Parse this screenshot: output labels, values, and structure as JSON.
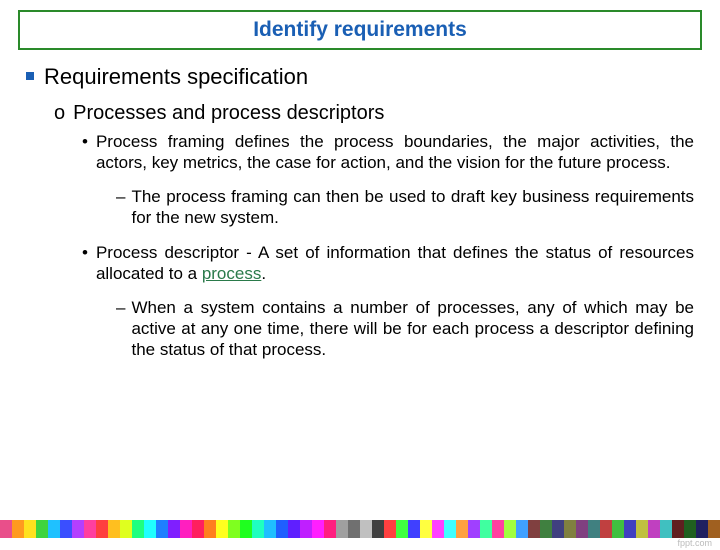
{
  "title": "Identify requirements",
  "lvl1": "Requirements specification",
  "lvl2": "Processes and process descriptors",
  "lvl3a": "Process framing defines the process boundaries, the major activities, the actors, key metrics, the case for action, and the vision for the future process.",
  "lvl4a": "The process framing can then be used to draft key business requirements for the new system.",
  "lvl3b_pre": "Process descriptor - A set of information that defines the status of resources allocated to a ",
  "lvl3b_link": "process",
  "lvl3b_post": ".",
  "lvl4b": "When a system contains a number of processes, any of which may be active at any one time, there will be for each process a descriptor defining the status of that process.",
  "watermark": "fppt.com",
  "bullets": {
    "circle": "o",
    "dot": "•",
    "dash": "–"
  },
  "strip_colors": [
    "#e94f8a",
    "#ff9a1f",
    "#ffe11f",
    "#3fd43f",
    "#1fc1ff",
    "#3a4fff",
    "#b33fff",
    "#ff3f9f",
    "#ff3f3f",
    "#ffbf1f",
    "#dfff1f",
    "#1fff7f",
    "#1fffff",
    "#1f7fff",
    "#7f1fff",
    "#ff1fbf",
    "#ff1f5f",
    "#ff7f1f",
    "#ffff1f",
    "#7fff1f",
    "#1fff1f",
    "#1fffbf",
    "#1fbfff",
    "#1f5fff",
    "#5f1fff",
    "#bf1fff",
    "#ff1fff",
    "#ff1f7f",
    "#a0a0a0",
    "#707070",
    "#c0c0c0",
    "#404040",
    "#ff4040",
    "#40ff40",
    "#4040ff",
    "#ffff40",
    "#ff40ff",
    "#40ffff",
    "#ffa040",
    "#a040ff",
    "#40ffa0",
    "#ff40a0",
    "#a0ff40",
    "#40a0ff",
    "#804040",
    "#408040",
    "#404080",
    "#808040",
    "#804080",
    "#408080",
    "#c04040",
    "#40c040",
    "#4040c0",
    "#c0c040",
    "#c040c0",
    "#40c0c0",
    "#602020",
    "#206020",
    "#202060",
    "#a06020"
  ]
}
